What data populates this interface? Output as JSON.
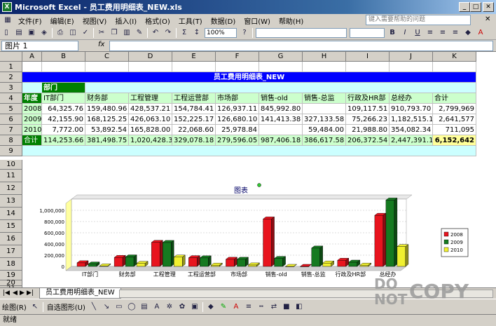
{
  "window": {
    "title": "Microsoft Excel - 员工费用明细表_NEW.xls"
  },
  "menu": {
    "items": [
      "文件(F)",
      "编辑(E)",
      "视图(V)",
      "插入(I)",
      "格式(O)",
      "工具(T)",
      "数据(D)",
      "窗口(W)",
      "帮助(H)"
    ],
    "help_placeholder": "键入需要帮助的问题"
  },
  "toolbar": {
    "zoom": "100%"
  },
  "formula": {
    "name_box": "图片 1",
    "fx": "fx"
  },
  "sheet": {
    "columns": [
      "A",
      "B",
      "C",
      "D",
      "E",
      "F",
      "G",
      "H",
      "I",
      "J",
      "K"
    ],
    "rows": [
      "1",
      "2",
      "3",
      "4",
      "5",
      "6",
      "7",
      "8",
      "9",
      "10",
      "11",
      "12",
      "13",
      "14",
      "15",
      "16",
      "17",
      "18",
      "19",
      "20",
      "21"
    ],
    "title": "员工费用明细表_NEW",
    "dept_label": "部门",
    "year_label": "年度",
    "headers": [
      "IT部门",
      "财务部",
      "工程管理",
      "工程运营部",
      "市场部",
      "销售-old",
      "销售-总监",
      "行政及HR部",
      "总经办",
      "合计"
    ],
    "data": [
      {
        "year": "2008",
        "values": [
          "64,325.76",
          "159,480.96",
          "428,537.21",
          "154,784.41",
          "126,937.11",
          "845,992.80",
          "",
          "109,117.51",
          "910,793.70",
          "2,799,969"
        ]
      },
      {
        "year": "2009",
        "values": [
          "42,155.90",
          "168,125.25",
          "426,063.10",
          "152,225.17",
          "126,680.10",
          "141,413.38",
          "327,133.58",
          "75,266.23",
          "1,182,515.10",
          "2,641,577"
        ]
      },
      {
        "year": "2010",
        "values": [
          "7,772.00",
          "53,892.54",
          "165,828.00",
          "22,068.60",
          "25,978.84",
          "",
          "59,484.00",
          "21,988.80",
          "354,082.34",
          "711,095"
        ]
      },
      {
        "year": "合计",
        "values": [
          "114,253.66",
          "381,498.75",
          "1,020,428.31",
          "329,078.18",
          "279,596.05",
          "987,406.18",
          "386,617.58",
          "206,372.54",
          "2,447,391.14",
          "6,152,642"
        ]
      }
    ]
  },
  "chart_data": {
    "type": "bar",
    "title": "图表",
    "categories": [
      "IT部门",
      "财务部",
      "工程管理",
      "工程运营部",
      "市场部",
      "销售-old",
      "销售-总监",
      "行政及HR部",
      "总经办"
    ],
    "series": [
      {
        "name": "2008",
        "color": "#e8141e",
        "values": [
          64325.76,
          159480.96,
          428537.21,
          154784.41,
          126937.11,
          845992.8,
          0,
          109117.51,
          910793.7
        ]
      },
      {
        "name": "2009",
        "color": "#157a20",
        "values": [
          42155.9,
          168125.25,
          426063.1,
          152225.17,
          126680.1,
          141413.38,
          327133.58,
          75266.23,
          1182515.1
        ]
      },
      {
        "name": "2010",
        "color": "#f0f030",
        "values": [
          7772.0,
          53892.54,
          165828.0,
          22068.6,
          25978.84,
          0,
          59484.0,
          21988.8,
          354082.34
        ]
      }
    ],
    "yticks": [
      "1,000,000",
      "800,000",
      "600,000",
      "400,000",
      "200,000",
      "0"
    ],
    "ylim": [
      0,
      1200000
    ],
    "legend": "right",
    "grid": true
  },
  "tabs": {
    "sheet_name": "员工费用明细表_NEW"
  },
  "drawbar": {
    "draw_label": "绘图(R)",
    "autoshape_label": "自选图形(U)"
  },
  "status": {
    "text": "就绪"
  },
  "watermark": {
    "text1": "DO",
    "text2": "NOT",
    "text3": "COPY"
  }
}
